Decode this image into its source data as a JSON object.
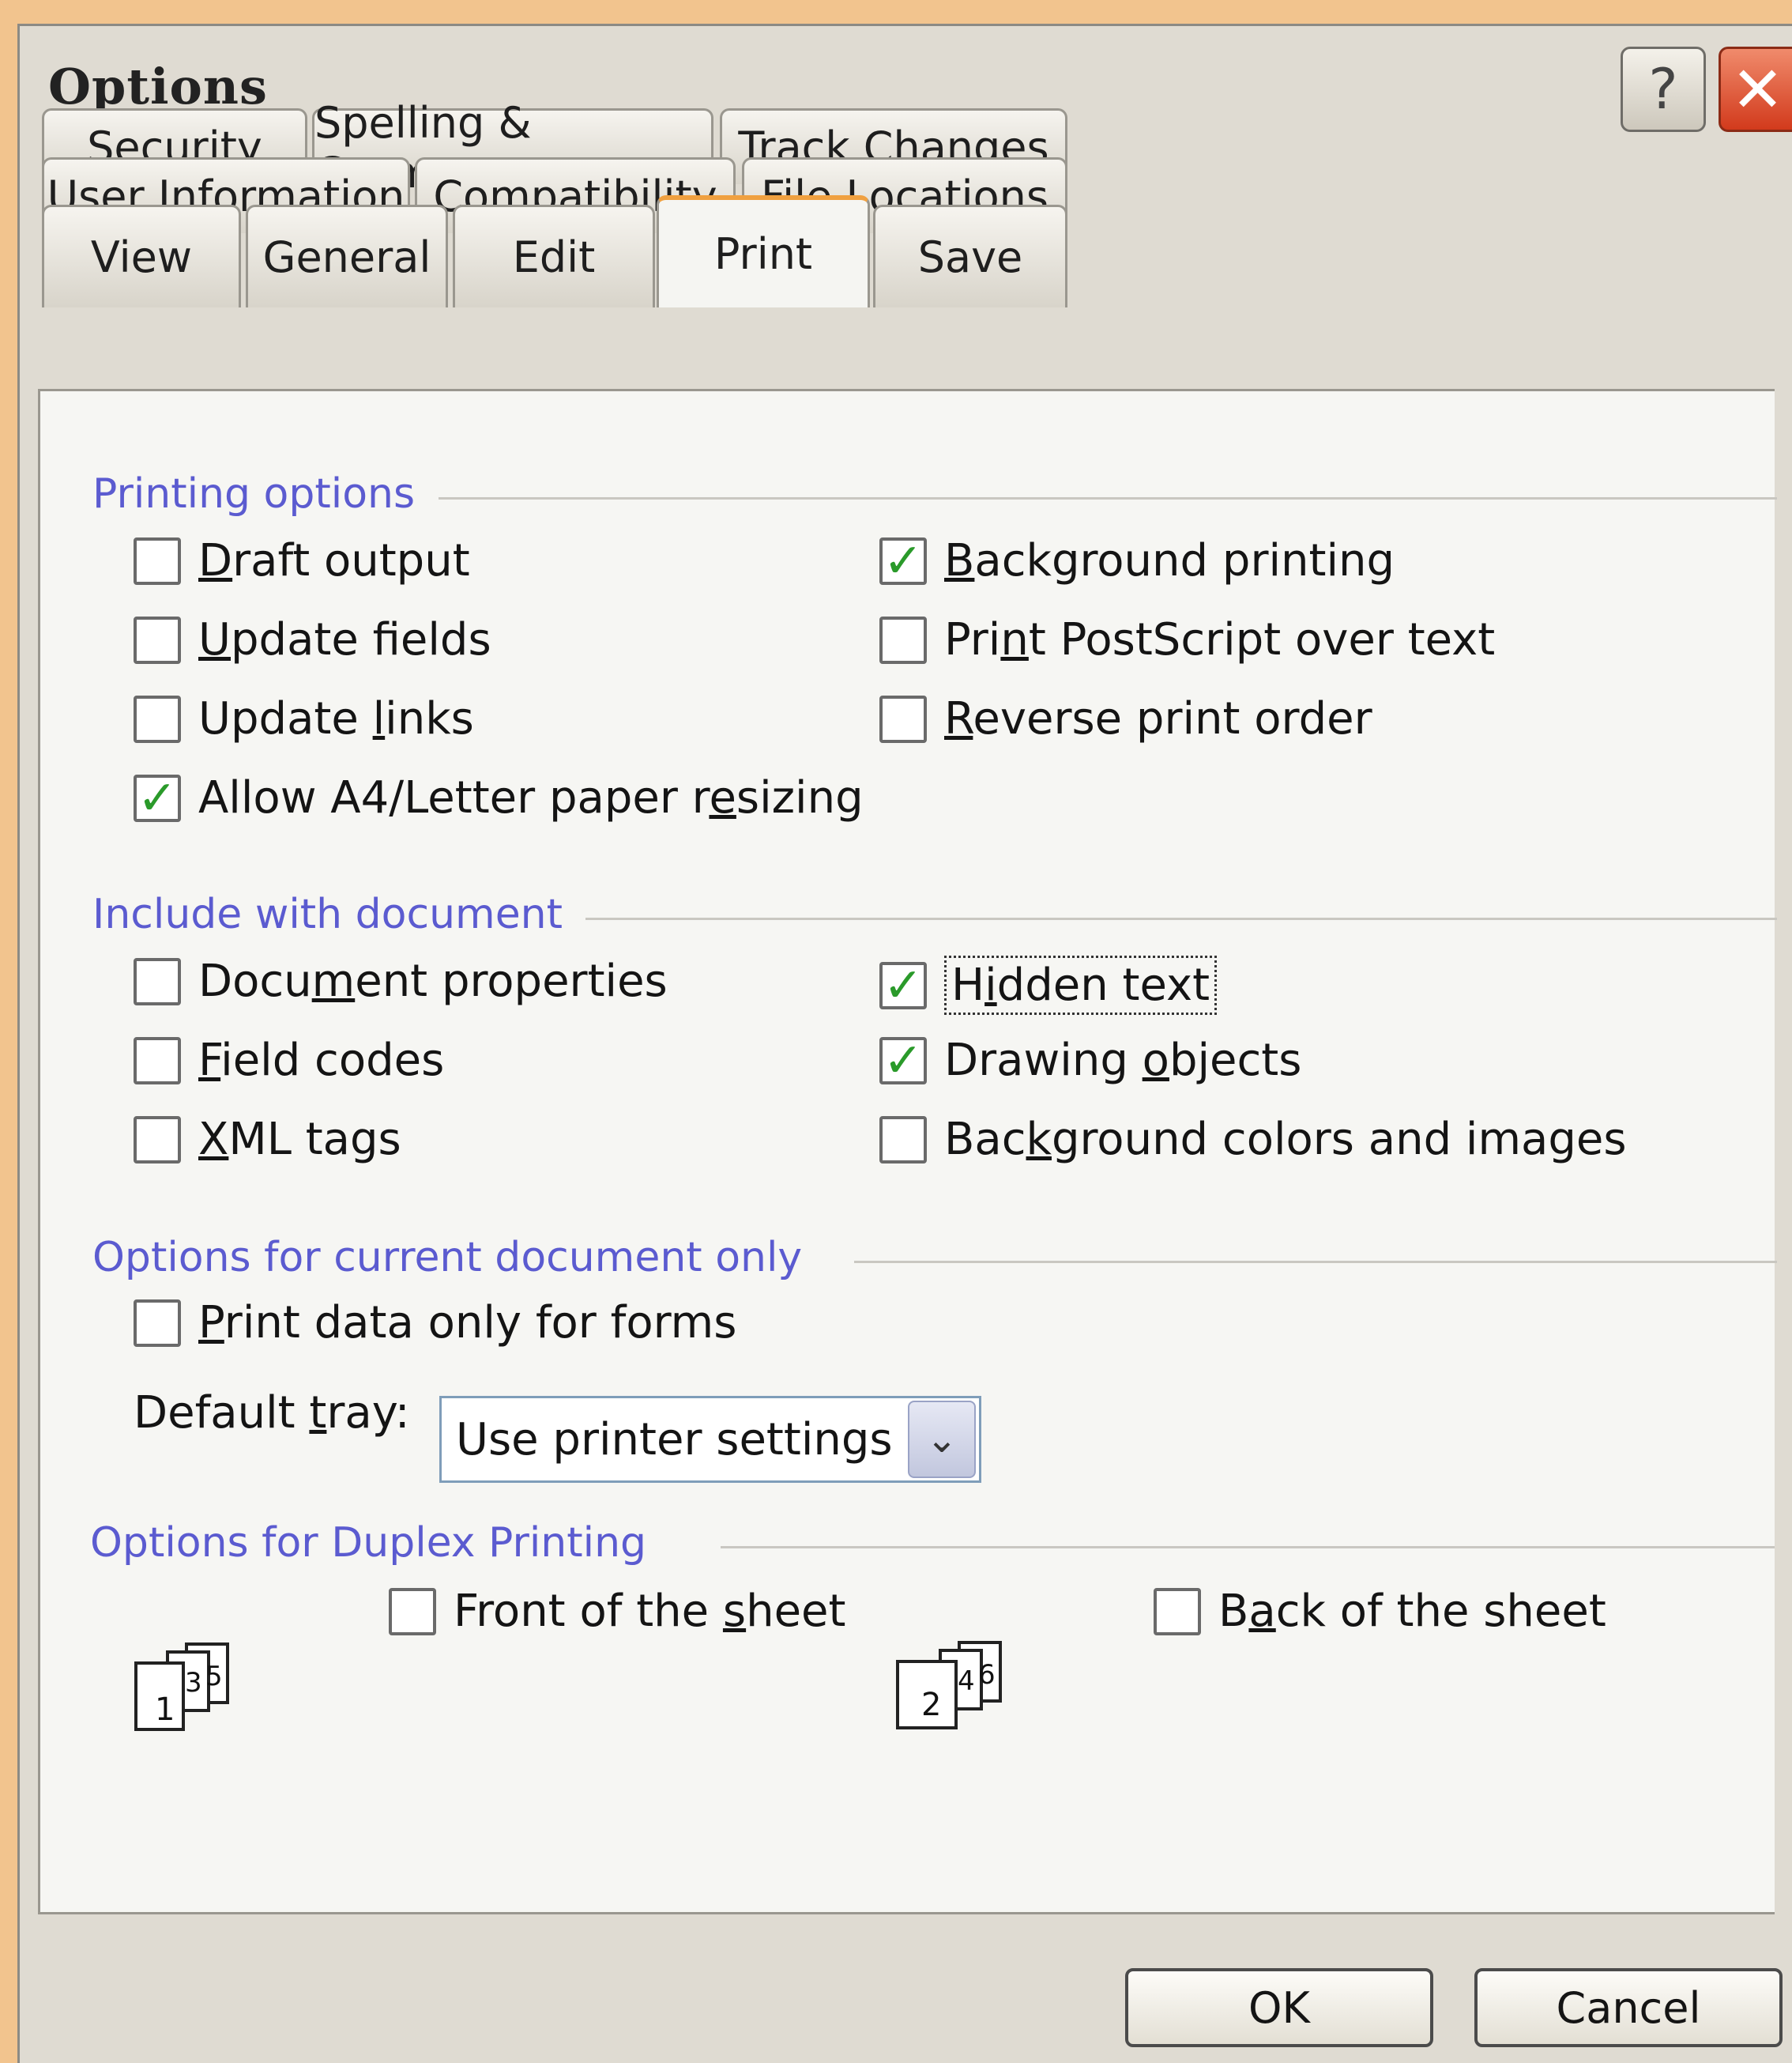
{
  "dialog": {
    "title": "Options"
  },
  "titlebar": {
    "help_glyph": "?",
    "close_glyph": "✕"
  },
  "tabs": {
    "row1": [
      "Security",
      "Spelling & Grammar",
      "Track Changes"
    ],
    "row2": [
      "User Information",
      "Compatibility",
      "File Locations"
    ],
    "row3": [
      "View",
      "General",
      "Edit",
      "Print",
      "Save"
    ],
    "active": "Print"
  },
  "printing_options": {
    "heading": "Printing options",
    "draft_output": {
      "pre": "",
      "key": "D",
      "post": "raft output",
      "checked": false
    },
    "update_fields": {
      "pre": "",
      "key": "U",
      "post": "pdate fields",
      "checked": false
    },
    "update_links": {
      "pre": "Update ",
      "key": "l",
      "post": "inks",
      "checked": false
    },
    "allow_resize": {
      "pre": "Allow A4/Letter paper r",
      "key": "e",
      "post": "sizing",
      "checked": true
    },
    "background_printing": {
      "pre": "",
      "key": "B",
      "post": "ackground printing",
      "checked": true
    },
    "print_postscript": {
      "pre": "Pri",
      "key": "n",
      "post": "t PostScript over text",
      "checked": false
    },
    "reverse_order": {
      "pre": "",
      "key": "R",
      "post": "everse print order",
      "checked": false
    }
  },
  "include_with_document": {
    "heading": "Include with document",
    "document_properties": {
      "pre": "Docu",
      "key": "m",
      "post": "ent properties",
      "checked": false
    },
    "field_codes": {
      "pre": "",
      "key": "F",
      "post": "ield codes",
      "checked": false
    },
    "xml_tags": {
      "pre": "",
      "key": "X",
      "post": "ML tags",
      "checked": false
    },
    "hidden_text": {
      "pre": "H",
      "key": "i",
      "post": "dden text",
      "checked": true
    },
    "drawing_objects": {
      "pre": "Drawing ",
      "key": "o",
      "post": "bjects",
      "checked": true
    },
    "background_colors": {
      "pre": "Bac",
      "key": "k",
      "post": "ground colors and images",
      "checked": false
    }
  },
  "current_document": {
    "heading": "Options for current document only",
    "print_data_forms": {
      "pre": "",
      "key": "P",
      "post": "rint data only for forms",
      "checked": false
    },
    "default_tray_label_pre": "Default ",
    "default_tray_label_key": "t",
    "default_tray_label_post": "ray:",
    "default_tray_value": "Use printer settings"
  },
  "duplex": {
    "heading": "Options for Duplex Printing",
    "front": {
      "pre": "Front of the ",
      "key": "s",
      "post": "heet",
      "checked": false
    },
    "back": {
      "pre": "B",
      "key": "a",
      "post": "ck of the sheet",
      "checked": false
    },
    "front_pages": [
      "1",
      "3",
      "5"
    ],
    "back_pages": [
      "2",
      "4",
      "6"
    ]
  },
  "buttons": {
    "ok": "OK",
    "cancel": "Cancel"
  },
  "colors": {
    "section_heading": "#5b5bd0",
    "check_mark": "#2a9a2a",
    "active_tab_accent": "#f0a040",
    "close_button": "#d23a1c"
  },
  "icons": {
    "help": "question-icon",
    "close": "close-x-icon",
    "dropdown": "chevron-down-icon",
    "checkmark": "check-icon",
    "duplex": "stacked-pages-icon"
  }
}
